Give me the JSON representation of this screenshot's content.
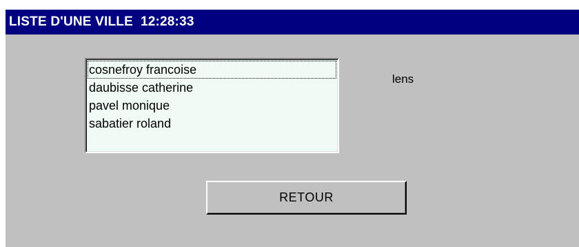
{
  "window": {
    "title": "LISTE D'UNE VILLE  12:28:33"
  },
  "listbox": {
    "items": [
      {
        "label": "cosnefroy francoise",
        "focused": true
      },
      {
        "label": "daubisse catherine",
        "focused": false
      },
      {
        "label": "pavel monique",
        "focused": false
      },
      {
        "label": "sabatier roland",
        "focused": false
      }
    ]
  },
  "city": {
    "label": "lens"
  },
  "buttons": {
    "back_label": "RETOUR"
  },
  "colors": {
    "titlebar": "#000080",
    "window_bg": "#c0c0c0",
    "listbox_bg": "#f0fbf6"
  }
}
